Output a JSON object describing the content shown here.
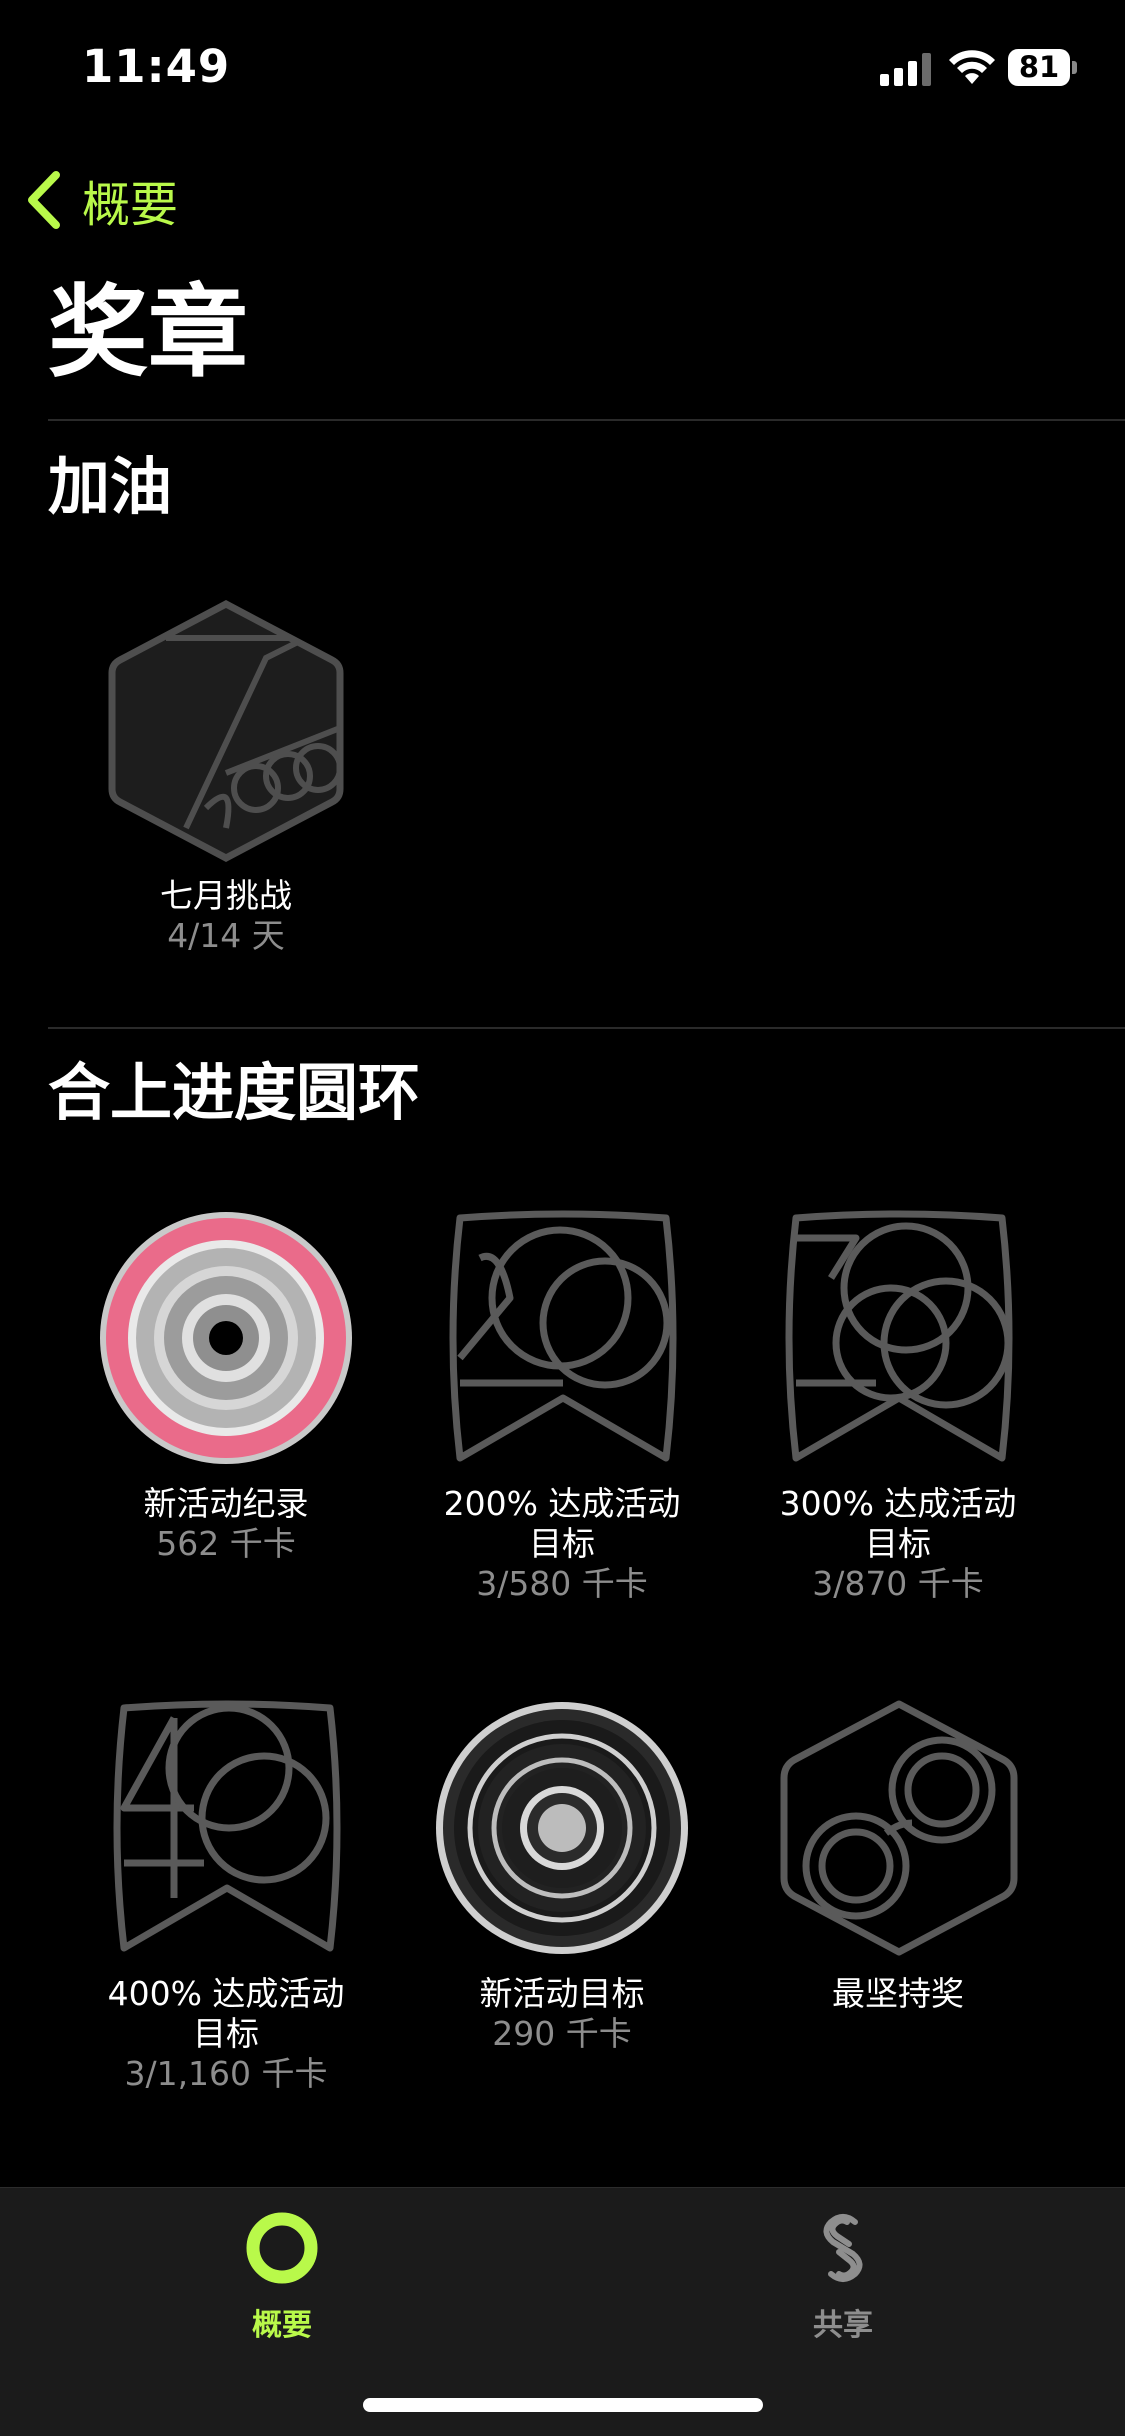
{
  "status": {
    "time": "11:49",
    "battery": "81"
  },
  "nav": {
    "back_label": "概要"
  },
  "page": {
    "title": "奖章"
  },
  "sections": [
    {
      "title": "加油",
      "awards": [
        {
          "name": "七月挑战",
          "detail": "4/14 天",
          "icon": "july-2023-challenge-icon"
        }
      ]
    },
    {
      "title": "合上进度圆环",
      "awards": [
        {
          "name": "新活动纪录",
          "detail": "562 千卡",
          "icon": "move-record-medal-icon"
        },
        {
          "name_line1": "200% 达成活动",
          "name_line2": "目标",
          "detail": "3/580 千卡",
          "icon": "200-percent-badge-icon"
        },
        {
          "name_line1": "300% 达成活动",
          "name_line2": "目标",
          "detail": "3/870 千卡",
          "icon": "300-percent-badge-icon"
        },
        {
          "name_line1": "400% 达成活动",
          "name_line2": "目标",
          "detail": "3/1,160 千卡",
          "icon": "400-percent-badge-icon"
        },
        {
          "name": "新活动目标",
          "detail": "290 千卡",
          "icon": "new-move-goal-medal-icon"
        },
        {
          "name": "最坚持奖",
          "detail": "",
          "icon": "longest-streak-badge-icon"
        }
      ]
    }
  ],
  "tabbar": {
    "tabs": [
      {
        "label": "概要",
        "icon": "activity-ring-icon",
        "active": true
      },
      {
        "label": "共享",
        "icon": "sharing-icon",
        "active": false
      }
    ]
  },
  "colors": {
    "accent": "#b9f94a",
    "move_pink": "#ea6b8a",
    "outline": "#5a5a5a"
  }
}
